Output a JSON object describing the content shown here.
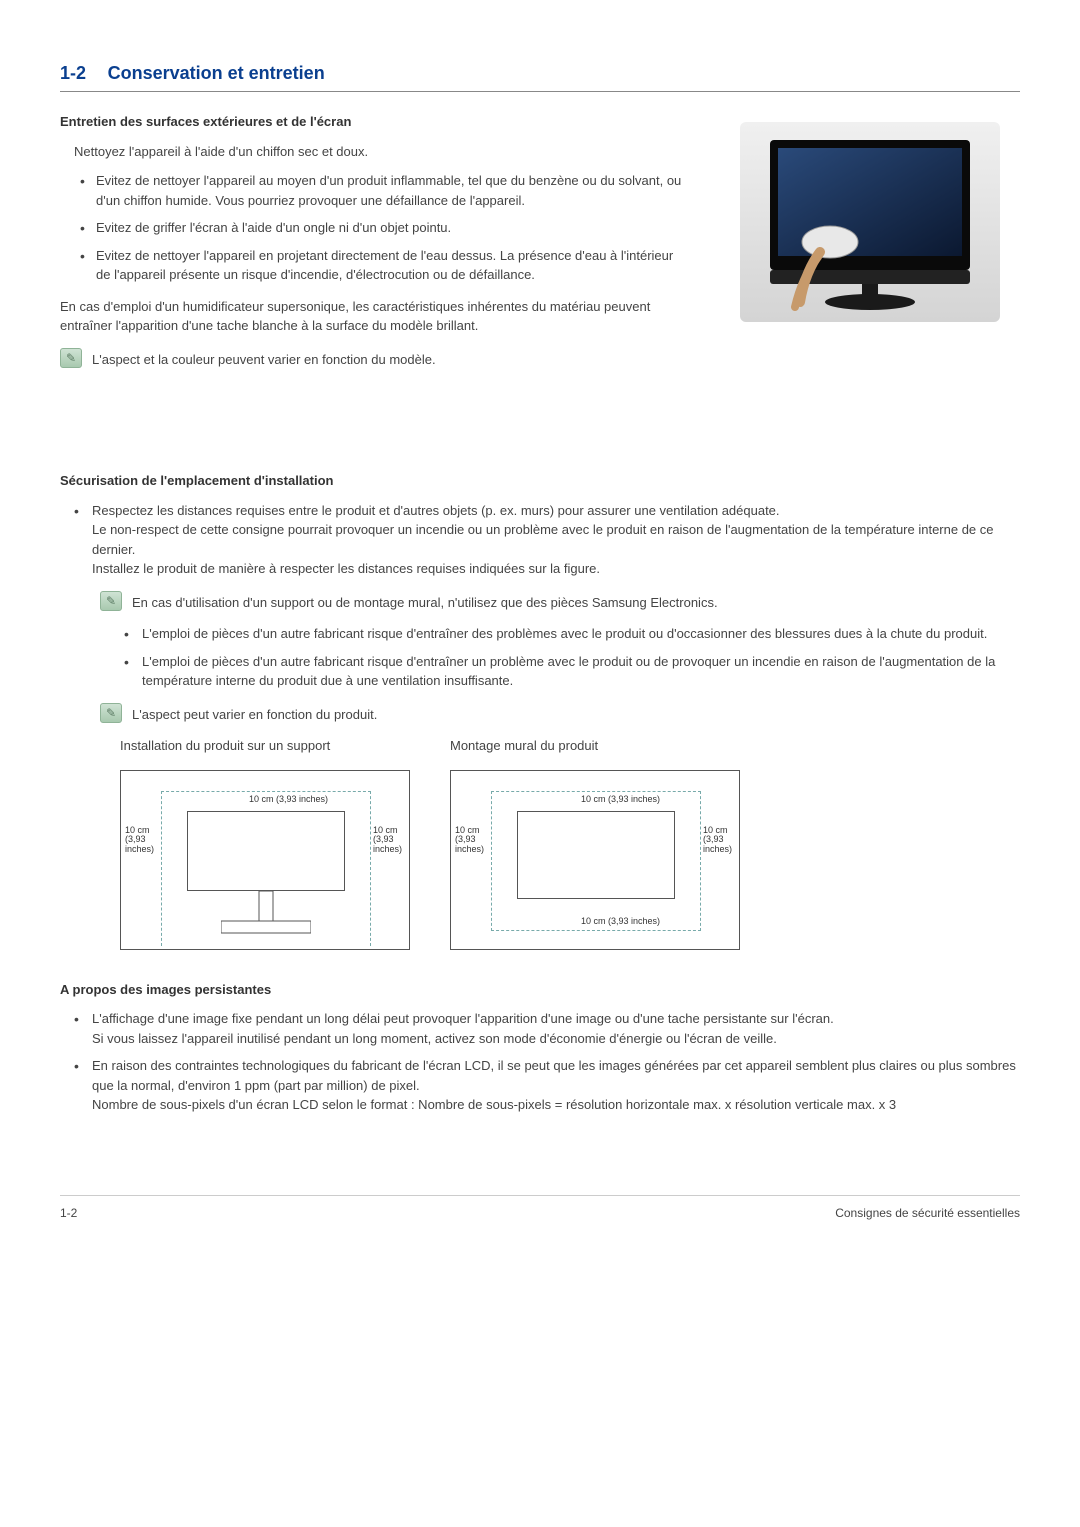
{
  "header": {
    "number": "1-2",
    "title": "Conservation et entretien"
  },
  "section1": {
    "heading": "Entretien des surfaces extérieures et de l'écran",
    "intro": "Nettoyez l'appareil à l'aide d'un chiffon sec et doux.",
    "bullets": [
      "Evitez de nettoyer l'appareil au moyen d'un produit inflammable, tel que du benzène ou du solvant, ou d'un chiffon humide. Vous pourriez provoquer une défaillance de l'appareil.",
      "Evitez de griffer l'écran à l'aide d'un ongle ni d'un objet pointu.",
      "Evitez de nettoyer l'appareil en projetant directement de l'eau dessus. La présence d'eau à l'intérieur de l'appareil présente un risque d'incendie, d'électrocution ou de défaillance."
    ],
    "para": "En cas d'emploi d'un humidificateur supersonique, les caractéristiques inhérentes du matériau peuvent entraîner l'apparition d'une tache blanche à la surface du modèle brillant.",
    "note": "L'aspect et la couleur peuvent varier en fonction du modèle."
  },
  "section2": {
    "heading": "Sécurisation de l'emplacement d'installation",
    "main_bullet": {
      "p1": "Respectez les distances requises entre le produit et d'autres objets (p. ex. murs) pour assurer une ventilation adéquate.",
      "p2": "Le non-respect de cette consigne pourrait provoquer un incendie ou un problème avec le produit en raison de l'augmentation de la température interne de ce dernier.",
      "p3": "Installez le produit de manière à respecter les distances requises indiquées sur la figure."
    },
    "note1": "En cas d'utilisation d'un support ou de montage mural, n'utilisez que des pièces Samsung Electronics.",
    "sub_bullets": [
      "L'emploi de pièces d'un autre fabricant risque d'entraîner des problèmes avec le produit ou d'occasionner des blessures dues à la chute du produit.",
      "L'emploi de pièces d'un autre fabricant risque d'entraîner un problème avec le produit ou de provoquer un incendie en raison de l'augmentation de la température interne du produit due à une ventilation insuffisante."
    ],
    "note2": "L'aspect peut varier en fonction du produit.",
    "diag1_title": "Installation du produit sur un support",
    "diag2_title": "Montage mural du produit",
    "label_top": "10 cm (3,93 inches)",
    "label_side": "10 cm\n(3,93\ninches)",
    "label_bottom": "10 cm (3,93 inches)"
  },
  "section3": {
    "heading": "A propos des images persistantes",
    "bullets": [
      {
        "p1": "L'affichage d'une image fixe pendant un long délai peut provoquer l'apparition d'une image ou d'une tache persistante sur l'écran.",
        "p2": "Si vous laissez l'appareil inutilisé pendant un long moment, activez son mode d'économie d'énergie ou l'écran de veille."
      },
      {
        "p1": "En raison des contraintes technologiques du fabricant de l'écran LCD, il se peut que les images générées par cet appareil semblent plus claires ou plus sombres que la normal, d'environ 1 ppm (part par million) de pixel.",
        "p2": "Nombre de sous-pixels d'un écran LCD selon le format : Nombre de sous-pixels = résolution horizontale max. x résolution verticale max. x 3"
      }
    ]
  },
  "footer": {
    "left": "1-2",
    "right": "Consignes de sécurité essentielles"
  }
}
